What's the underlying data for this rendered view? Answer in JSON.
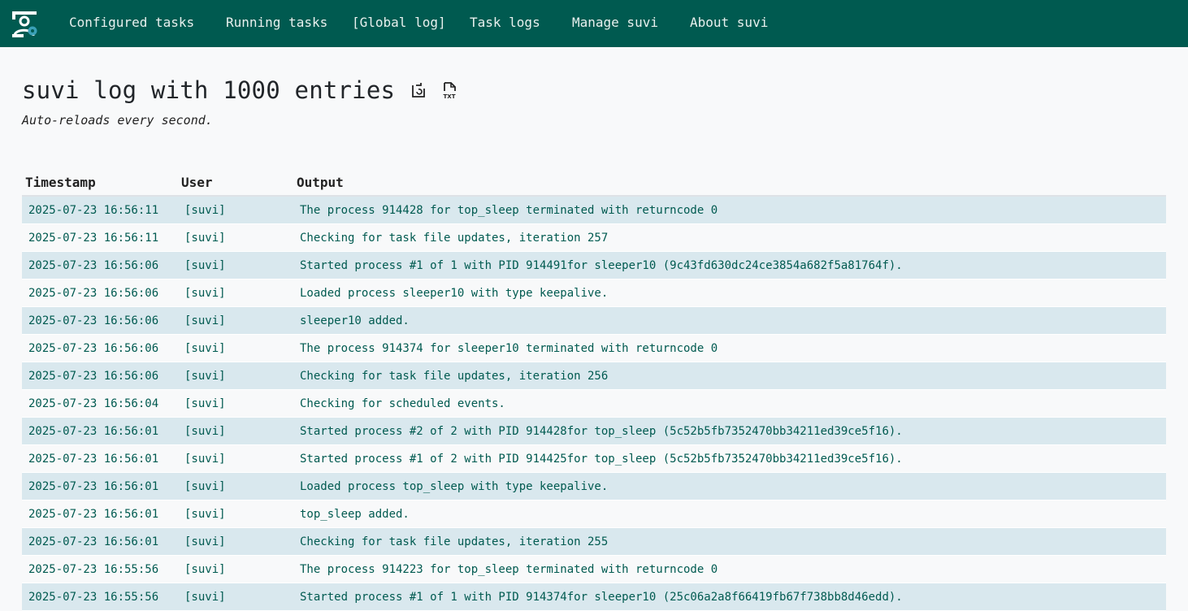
{
  "nav": {
    "items": [
      {
        "label": "Configured tasks"
      },
      {
        "label": "Running tasks"
      },
      {
        "label": "[Global log]"
      },
      {
        "label": "Task logs"
      },
      {
        "label": "Manage suvi"
      },
      {
        "label": "About suvi"
      }
    ]
  },
  "page": {
    "title": "suvi log with 1000 entries",
    "subtitle": "Auto-reloads every second.",
    "icons": [
      "reload-file-icon",
      "txt-file-icon"
    ]
  },
  "table": {
    "headers": [
      "Timestamp",
      "User",
      "Output"
    ],
    "rows": [
      {
        "timestamp": "2025-07-23 16:56:11",
        "user": "[suvi]",
        "output": "The process 914428 for top_sleep terminated with returncode 0"
      },
      {
        "timestamp": "2025-07-23 16:56:11",
        "user": "[suvi]",
        "output": "Checking for task file updates, iteration 257"
      },
      {
        "timestamp": "2025-07-23 16:56:06",
        "user": "[suvi]",
        "output": "Started process #1 of 1 with PID 914491for sleeper10 (9c43fd630dc24ce3854a682f5a81764f)."
      },
      {
        "timestamp": "2025-07-23 16:56:06",
        "user": "[suvi]",
        "output": "Loaded process sleeper10 with type keepalive."
      },
      {
        "timestamp": "2025-07-23 16:56:06",
        "user": "[suvi]",
        "output": "sleeper10 added."
      },
      {
        "timestamp": "2025-07-23 16:56:06",
        "user": "[suvi]",
        "output": "The process 914374 for sleeper10 terminated with returncode 0"
      },
      {
        "timestamp": "2025-07-23 16:56:06",
        "user": "[suvi]",
        "output": "Checking for task file updates, iteration 256"
      },
      {
        "timestamp": "2025-07-23 16:56:04",
        "user": "[suvi]",
        "output": "Checking for scheduled events."
      },
      {
        "timestamp": "2025-07-23 16:56:01",
        "user": "[suvi]",
        "output": "Started process #2 of 2 with PID 914428for top_sleep (5c52b5fb7352470bb34211ed39ce5f16)."
      },
      {
        "timestamp": "2025-07-23 16:56:01",
        "user": "[suvi]",
        "output": "Started process #1 of 2 with PID 914425for top_sleep (5c52b5fb7352470bb34211ed39ce5f16)."
      },
      {
        "timestamp": "2025-07-23 16:56:01",
        "user": "[suvi]",
        "output": "Loaded process top_sleep with type keepalive."
      },
      {
        "timestamp": "2025-07-23 16:56:01",
        "user": "[suvi]",
        "output": "top_sleep added."
      },
      {
        "timestamp": "2025-07-23 16:56:01",
        "user": "[suvi]",
        "output": "Checking for task file updates, iteration 255"
      },
      {
        "timestamp": "2025-07-23 16:55:56",
        "user": "[suvi]",
        "output": "The process 914223 for top_sleep terminated with returncode 0"
      },
      {
        "timestamp": "2025-07-23 16:55:56",
        "user": "[suvi]",
        "output": "Started process #1 of 1 with PID 914374for sleeper10 (25c06a2a8f66419fb67f738bb8d46edd)."
      }
    ]
  },
  "colors": {
    "navbar": "#005a50",
    "row_stripe": "#d9e8ee",
    "text_accent": "#005a50"
  }
}
